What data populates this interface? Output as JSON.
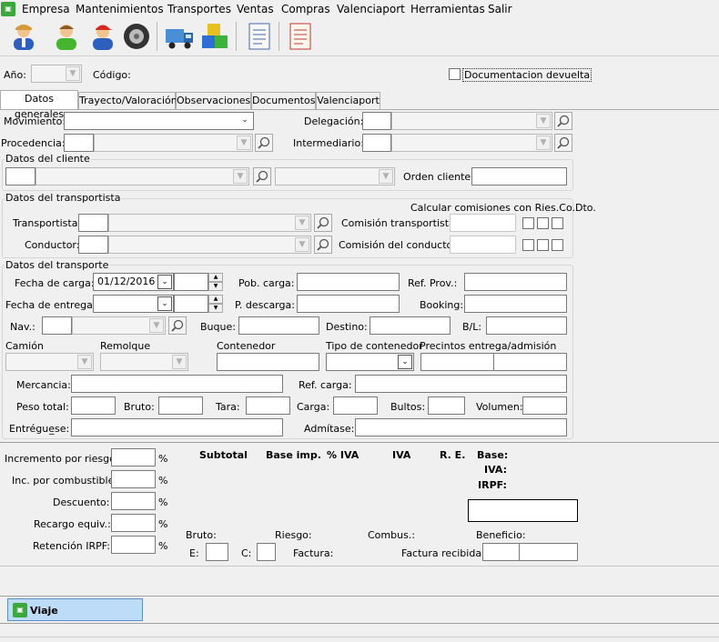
{
  "menu": [
    "Empresa",
    "Mantenimientos",
    "Transportes",
    "Ventas",
    "Compras",
    "Valenciaport",
    "Herramientas",
    "Salir"
  ],
  "toolbar": {
    "buttons": [
      {
        "name": "user-blue-icon"
      },
      {
        "name": "user-green-icon"
      },
      {
        "name": "user-red-cap-icon"
      },
      {
        "name": "tire-icon"
      },
      {
        "name": "truck-icon"
      },
      {
        "name": "boxes-icon"
      },
      {
        "name": "document-icon"
      },
      {
        "name": "report-icon"
      }
    ]
  },
  "header": {
    "ano_label": "Año:",
    "codigo_label": "Código:",
    "doc_devuelta_label": "Documentacion devuelta"
  },
  "tabs": [
    "Datos generales",
    "Trayecto/Valoración",
    "Observaciones",
    "Documentos",
    "Valenciaport"
  ],
  "general": {
    "movimiento_label": "Movimiento:",
    "delegacion_label": "Delegación:",
    "procedencia_label": "Procedencia:",
    "intermediario_label": "Intermediario:"
  },
  "cliente": {
    "title": "Datos del cliente",
    "orden_label": "Orden cliente:"
  },
  "transportista": {
    "title": "Datos del transportista",
    "comisiones_label": "Calcular comisiones con Ries.Co.Dto.",
    "transportista_label": "Transportista:",
    "comision_transportista_label": "Comisión transportista:",
    "conductor_label": "Conductor:",
    "comision_conductor_label": "Comisión del conductor:"
  },
  "transporte": {
    "title": "Datos del transporte",
    "fecha_carga_label": "Fecha de carga:",
    "fecha_carga_value": "01/12/2016",
    "pob_carga_label": "Pob. carga:",
    "ref_prov_label": "Ref. Prov.:",
    "fecha_entrega_label": "Fecha de entrega:",
    "p_descarga_label": "P. descarga:",
    "booking_label": "Booking:",
    "nav_label": "Nav.:",
    "buque_label": "Buque:",
    "destino_label": "Destino:",
    "bl_label": "B/L:",
    "camion_label": "Camión",
    "remolque_label": "Remolque",
    "contenedor_label": "Contenedor",
    "tipo_contenedor_label": "Tipo de contenedor",
    "precintos_label": "Precintos entrega/admisión",
    "mercancia_label": "Mercancia:",
    "ref_carga_label": "Ref. carga:",
    "peso_total_label": "Peso total:",
    "bruto_label": "Bruto:",
    "tara_label": "Tara:",
    "carga_label": "Carga:",
    "bultos_label": "Bultos:",
    "volumen_label": "Volumen:",
    "entreguese_label": "Entrégue̲se:",
    "admitase_label": "Admítase:"
  },
  "totals": {
    "incremento_label": "Incremento por riesgo:",
    "combustible_label": "Inc. por combustible:",
    "descuento_label": "Descuento:",
    "recargo_label": "Recargo equiv.:",
    "retencion_label": "Retención IRPF:",
    "pct": "%",
    "subtotal_label": "Subtotal",
    "base_imp_label": "Base imp.",
    "pct_iva_label": "% IVA",
    "iva_label": "IVA",
    "re_label": "R. E.",
    "base_label": "Base:",
    "iva2_label": "IVA:",
    "irpf_label": "IRPF:",
    "bruto_label": "Bruto:",
    "riesgo_label": "Riesgo:",
    "combus_label": "Combus.:",
    "beneficio_label": "Beneficio:",
    "e_label": "E:",
    "c_label": "C:",
    "factura_label": "Factura:",
    "factura_recibida_label": "Factura recibida:"
  },
  "taskbar": {
    "window_label": "Viaje"
  },
  "colors": {
    "taskbar_button": "#bcdcf8",
    "app_icon_green": "#3aa83a"
  }
}
